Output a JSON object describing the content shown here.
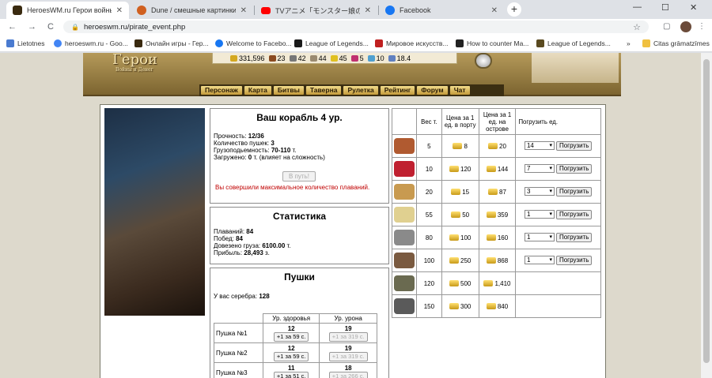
{
  "browser": {
    "tabs": [
      {
        "title": "HeroesWM.ru Герои войны и де",
        "active": true,
        "favicon_color": "#3a2a10"
      },
      {
        "title": "Dune / смешные картинки и др",
        "active": false,
        "favicon_color": "#d06020"
      },
      {
        "title": "TVアニメ「モンスター娘のお医者さん」",
        "active": false,
        "favicon_color": "#ff0000"
      },
      {
        "title": "Facebook",
        "active": false,
        "favicon_color": "#1877f2"
      }
    ],
    "new_tab_label": "+",
    "window_controls": {
      "minimize": "—",
      "maximize": "☐",
      "close": "✕"
    },
    "url": "heroeswm.ru/pirate_event.php",
    "nav": {
      "back": "←",
      "forward": "→",
      "reload": "C"
    },
    "bookmarks": [
      {
        "label": "Lietotnes",
        "color": "#4a7bd0"
      },
      {
        "label": "heroeswm.ru - Goo...",
        "color": "#4285f4"
      },
      {
        "label": "Онлайн игры - Гер...",
        "color": "#3a2a10"
      },
      {
        "label": "Welcome to Facebo...",
        "color": "#1877f2"
      },
      {
        "label": "League of Legends...",
        "color": "#1a1a1a"
      },
      {
        "label": "Мировое искусств...",
        "color": "#c02020"
      },
      {
        "label": "How to counter Ma...",
        "color": "#222222"
      },
      {
        "label": "League of Legends...",
        "color": "#5a4a20"
      },
      {
        "label": "»",
        "color": ""
      },
      {
        "label": "Citas grāmatzīmes",
        "color": "#f0c040"
      }
    ]
  },
  "game": {
    "logo_title": "Герои",
    "logo_subtitle": "Войны и Денег",
    "resources": [
      {
        "value": "331,596",
        "color": "#d4a820",
        "icon": "gold-icon"
      },
      {
        "value": "23",
        "color": "#8a4a20",
        "icon": "wood-icon"
      },
      {
        "value": "42",
        "color": "#777777",
        "icon": "ore-icon"
      },
      {
        "value": "44",
        "color": "#9a8a70",
        "icon": "mercury-icon"
      },
      {
        "value": "45",
        "color": "#e0c020",
        "icon": "sulfur-icon"
      },
      {
        "value": "5",
        "color": "#c03070",
        "icon": "crystal-icon"
      },
      {
        "value": "10",
        "color": "#50a0d0",
        "icon": "gem-icon"
      },
      {
        "value": "18.4",
        "color": "#6080c0",
        "icon": "diamond-icon"
      }
    ],
    "menu": [
      "Персонаж",
      "Карта",
      "Битвы",
      "Таверна",
      "Рулетка",
      "Рейтинг",
      "Форум",
      "Чат"
    ],
    "ship": {
      "title": "Ваш корабль 4 ур.",
      "durability_label": "Прочность:",
      "durability": "12/36",
      "cannons_label": "Количество пушек:",
      "cannons": "3",
      "capacity_label": "Грузоподьемность:",
      "capacity": "70-110",
      "capacity_unit": "т.",
      "loaded_label": "Загружено:",
      "loaded": "0",
      "loaded_note": "т. (влияет на сложность)",
      "sail_button": "В путь!",
      "max_message": "Вы совершили максимальное количество плаваний."
    },
    "stats": {
      "title": "Статистика",
      "voyages_label": "Плаваний:",
      "voyages": "84",
      "wins_label": "Побед:",
      "wins": "84",
      "cargo_label": "Довезено груза:",
      "cargo": "6100.00",
      "cargo_unit": "т.",
      "profit_label": "Прибыль:",
      "profit": "28,493",
      "profit_unit": "з."
    },
    "guns": {
      "title": "Пушки",
      "silver_label": "У вас серебра:",
      "silver": "128",
      "col_health": "Ур. здоровья",
      "col_damage": "Ур. урона",
      "rows": [
        {
          "name": "Пушка №1",
          "health": "12",
          "health_btn": "+1 за 59 с.",
          "damage": "19",
          "damage_btn": "+1 за 319 с."
        },
        {
          "name": "Пушка №2",
          "health": "12",
          "health_btn": "+1 за 59 с.",
          "damage": "19",
          "damage_btn": "+1 за 319 с."
        },
        {
          "name": "Пушка №3",
          "health": "11",
          "health_btn": "+1 за 51 с.",
          "damage": "18",
          "damage_btn": "+1 за 266 с."
        }
      ]
    },
    "cargo_table": {
      "headers": {
        "weight": "Вес т.",
        "price_port": "Цена за 1 ед. в порту",
        "price_island": "Цена за 1 ед. на острове",
        "load": "Погрузить ед."
      },
      "load_button": "Погрузить",
      "rows": [
        {
          "icon": "sack-icon",
          "color": "#b05a30",
          "weight": "5",
          "port": "8",
          "island": "20",
          "qty": "14"
        },
        {
          "icon": "wine-icon",
          "color": "#c02030",
          "weight": "10",
          "port": "120",
          "island": "144",
          "qty": "7"
        },
        {
          "icon": "planks-icon",
          "color": "#c89a50",
          "weight": "20",
          "port": "15",
          "island": "87",
          "qty": "3"
        },
        {
          "icon": "sand-icon",
          "color": "#e0d090",
          "weight": "55",
          "port": "50",
          "island": "359",
          "qty": "1"
        },
        {
          "icon": "gravel-icon",
          "color": "#8a8a8a",
          "weight": "80",
          "port": "100",
          "island": "160",
          "qty": "1"
        },
        {
          "icon": "pot-icon",
          "color": "#7a5a40",
          "weight": "100",
          "port": "250",
          "island": "868",
          "qty": "1"
        },
        {
          "icon": "herbs-icon",
          "color": "#6a6a50",
          "weight": "120",
          "port": "500",
          "island": "1,410",
          "qty": ""
        },
        {
          "icon": "rods-icon",
          "color": "#5a5a5a",
          "weight": "150",
          "port": "300",
          "island": "840",
          "qty": ""
        }
      ]
    }
  }
}
